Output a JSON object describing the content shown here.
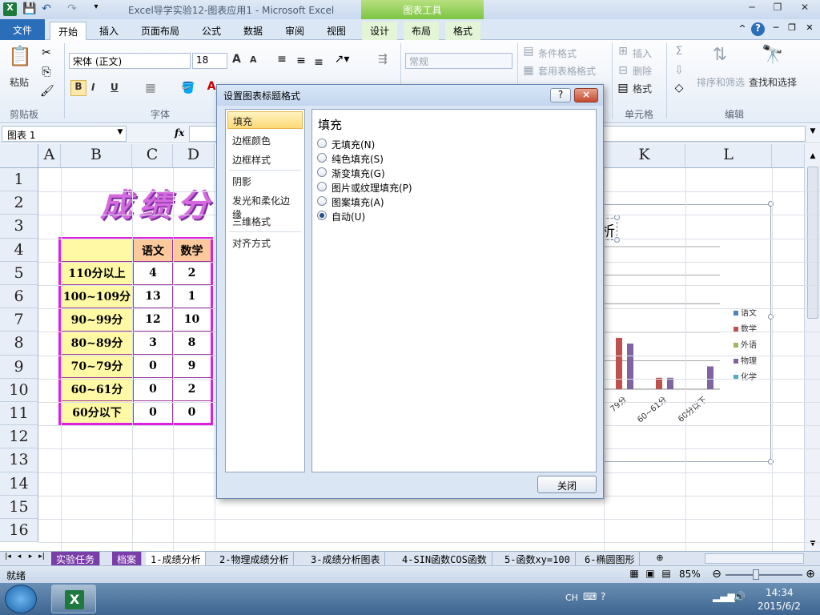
{
  "window": {
    "title": "Excel导学实验12-图表应用1 - Microsoft Excel",
    "context_tab_group": "图表工具"
  },
  "tabs": {
    "file": "文件",
    "items": [
      "开始",
      "插入",
      "页面布局",
      "公式",
      "数据",
      "审阅",
      "视图"
    ],
    "context_items": [
      "设计",
      "布局",
      "格式"
    ]
  },
  "ribbon": {
    "clipboard": {
      "paste": "粘贴",
      "label": "剪贴板"
    },
    "font": {
      "name": "宋体 (正文)",
      "size": "18",
      "label": "字体"
    },
    "number": {
      "format": "常规"
    },
    "styles": {
      "conditional": "条件格式",
      "table_format": "套用表格格式"
    },
    "cells": {
      "insert": "插入",
      "delete": "删除",
      "format": "格式",
      "label": "单元格"
    },
    "editing": {
      "sort_filter": "排序和筛选",
      "find_select": "查找和选择",
      "label": "编辑"
    }
  },
  "formula_bar": {
    "name_box": "图表 1",
    "fx": "fx"
  },
  "sheet": {
    "columns": [
      "A",
      "B",
      "C",
      "D",
      "K",
      "L"
    ],
    "rows": [
      "1",
      "2",
      "3",
      "4",
      "5",
      "6",
      "7",
      "8",
      "9",
      "10",
      "11",
      "12",
      "13",
      "14",
      "15",
      "16"
    ],
    "title_text": "成绩分"
  },
  "table": {
    "headers": [
      "",
      "语文",
      "数学"
    ],
    "rows": [
      {
        "label": "110分以上",
        "values": [
          "4",
          "2"
        ]
      },
      {
        "label": "100~109分",
        "values": [
          "13",
          "1"
        ]
      },
      {
        "label": "90~99分",
        "values": [
          "12",
          "10"
        ]
      },
      {
        "label": "80~89分",
        "values": [
          "3",
          "8"
        ]
      },
      {
        "label": "70~79分",
        "values": [
          "0",
          "9"
        ]
      },
      {
        "label": "60~61分",
        "values": [
          "0",
          "2"
        ]
      },
      {
        "label": "60分以下",
        "values": [
          "0",
          "0"
        ]
      }
    ]
  },
  "chart_data": {
    "type": "bar",
    "title": "析",
    "categories": [
      "79分",
      "60~61分",
      "60分以下"
    ],
    "series": [
      {
        "name": "语文",
        "color": "#4f81bd",
        "values": [
          0,
          0,
          0
        ]
      },
      {
        "name": "数学",
        "color": "#c0504d",
        "values": [
          9,
          2,
          0
        ]
      },
      {
        "name": "外语",
        "color": "#9bbb59",
        "values": [
          0,
          0,
          0
        ]
      },
      {
        "name": "物理",
        "color": "#8064a2",
        "values": [
          8,
          2,
          4
        ]
      },
      {
        "name": "化学",
        "color": "#4bacc6",
        "values": [
          0,
          0,
          0
        ]
      }
    ],
    "ylim": [
      0,
      25
    ],
    "legend": "right",
    "grid": true
  },
  "dialog": {
    "title": "设置图表标题格式",
    "help": "?",
    "close_x": "×",
    "nav": [
      "填充",
      "边框颜色",
      "边框样式",
      "阴影",
      "发光和柔化边缘",
      "三维格式",
      "对齐方式"
    ],
    "selected_nav": "填充",
    "section_title": "填充",
    "options": [
      {
        "label": "无填充(N)",
        "checked": false
      },
      {
        "label": "纯色填充(S)",
        "checked": false
      },
      {
        "label": "渐变填充(G)",
        "checked": false
      },
      {
        "label": "图片或纹理填充(P)",
        "checked": false
      },
      {
        "label": "图案填充(A)",
        "checked": false
      },
      {
        "label": "自动(U)",
        "checked": true
      }
    ],
    "close_button": "关闭"
  },
  "sheet_tabs": [
    "实验任务",
    "档案",
    "1-成绩分析",
    "2-物理成绩分析",
    "3-成绩分析图表",
    "4-SIN函数COS函数",
    "5-函数xy=100",
    "6-椭圆图形"
  ],
  "status": {
    "ready": "就绪",
    "zoom": "85%"
  },
  "taskbar": {
    "lang": "CH",
    "time": "14:34",
    "date": "2015/6/2"
  }
}
